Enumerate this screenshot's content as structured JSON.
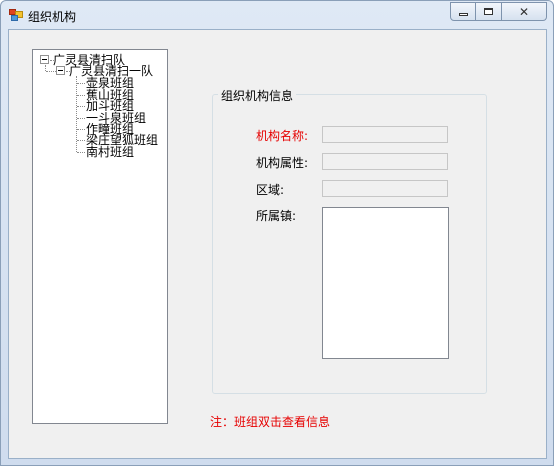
{
  "window": {
    "title": "组织机构"
  },
  "tree": {
    "root": "广灵县清扫队",
    "child": "广灵县清扫一队",
    "leaves": [
      "壶泉班组",
      "蕉山班组",
      "加斗班组",
      "一斗泉班组",
      "作疃班组",
      "梁庄望狐班组",
      "南村班组"
    ]
  },
  "info": {
    "group_title": "组织机构信息",
    "name_label": "机构名称:",
    "name_value": "",
    "attr_label": "机构属性:",
    "attr_value": "",
    "region_label": "区域:",
    "region_value": "",
    "town_label": "所属镇:",
    "town_value": ""
  },
  "note": "注：班组双击查看信息",
  "colors": {
    "required": "#e60000"
  }
}
